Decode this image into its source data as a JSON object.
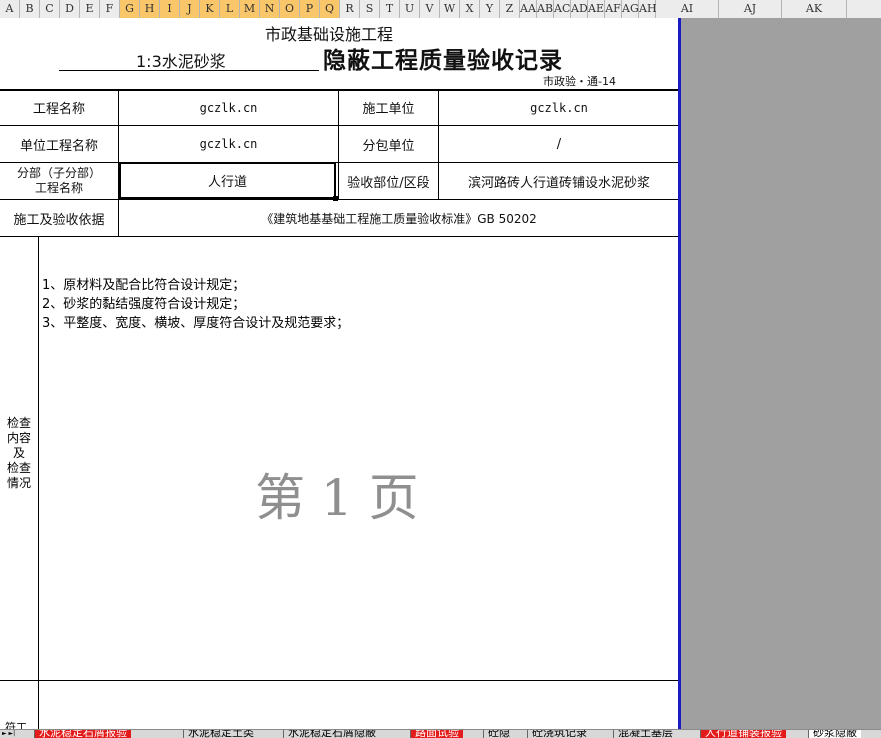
{
  "column_headers": [
    "A",
    "B",
    "C",
    "D",
    "E",
    "F",
    "G",
    "H",
    "I",
    "J",
    "K",
    "L",
    "M",
    "N",
    "O",
    "P",
    "Q",
    "R",
    "S",
    "T",
    "U",
    "V",
    "W",
    "X",
    "Y",
    "Z",
    "AA",
    "AB",
    "AC",
    "AD",
    "AE",
    "AF",
    "AG",
    "AH",
    "AI",
    "AJ",
    "AK"
  ],
  "form": {
    "org_title": "市政基础设施工程",
    "subject": "1:3水泥砂浆",
    "main_title": "隐蔽工程质量验收记录",
    "form_code": "市政验・通-14",
    "rows": {
      "project_name_label": "工程名称",
      "project_name_value": "gczlk.cn",
      "contractor_label": "施工单位",
      "contractor_value": "gczlk.cn",
      "unit_project_label": "单位工程名称",
      "unit_project_value": "gczlk.cn",
      "subcontractor_label": "分包单位",
      "subcontractor_value": "/",
      "subdivision_label_1": "分部（子分部）",
      "subdivision_label_2": "工程名称",
      "subdivision_value": "人行道",
      "location_label": "验收部位/区段",
      "location_value": "滨河路砖人行道砖铺设水泥砂浆",
      "basis_label": "施工及验收依据",
      "basis_value": "《建筑地基基础工程施工质量验收标准》GB 50202"
    },
    "inspection_label_chars": [
      "检查",
      "内容",
      "及",
      "检查",
      "情况"
    ],
    "inspection_items": [
      "1、原材料及配合比符合设计规定；",
      "2、砂浆的黏结强度符合设计规定；",
      "3、平整度、宽度、横坡、厚度符合设计及规范要求；"
    ],
    "page_watermark": "第 1 页",
    "bottom_label_partial": "符工"
  },
  "sheet_tabs": [
    {
      "label": "水泥稳定石屑报验",
      "style": "red"
    },
    {
      "label": "水泥稳定土类",
      "style": "normal"
    },
    {
      "label": "水泥稳定石屑隐蔽",
      "style": "normal"
    },
    {
      "label": "路面试验",
      "style": "red"
    },
    {
      "label": "砼隐",
      "style": "normal"
    },
    {
      "label": "砼浇筑记录",
      "style": "normal"
    },
    {
      "label": "混凝土基层",
      "style": "normal"
    },
    {
      "label": "人行道铺装报验",
      "style": "red"
    },
    {
      "label": "砂浆隐蔽",
      "style": "active"
    }
  ],
  "tab_nav_glyph": "►  ►|",
  "colors": {
    "selected_column": "#f9c76a",
    "sheet_boundary": "#1b1bc6",
    "red_tab": "#e31b1b",
    "outside_area": "#a0a0a0"
  }
}
